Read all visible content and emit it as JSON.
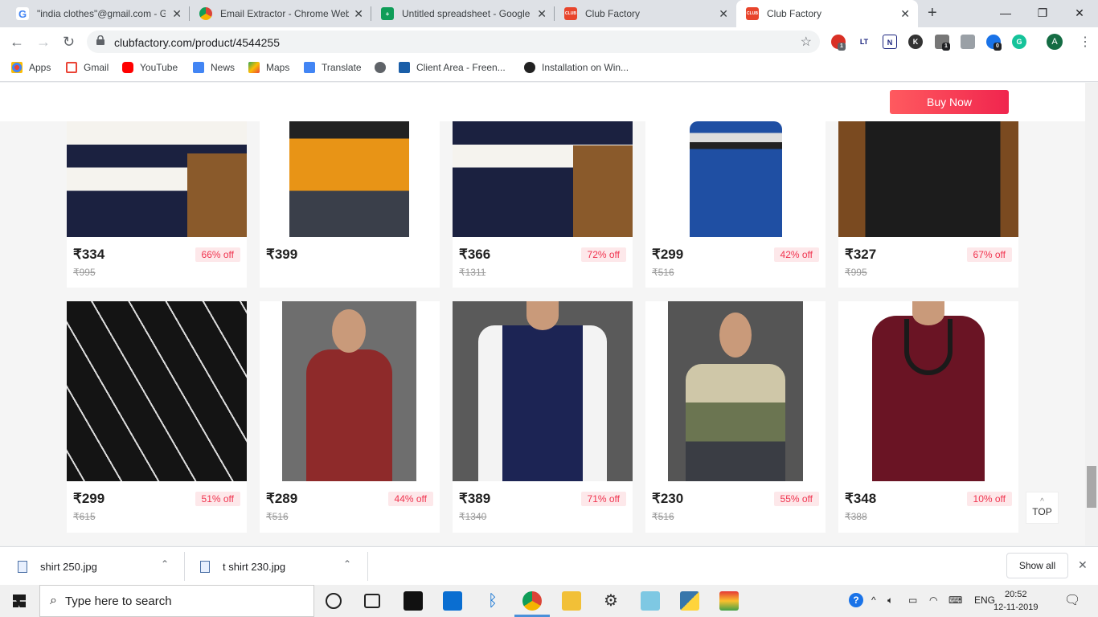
{
  "browser": {
    "tabs": [
      {
        "title": "\"india clothes\"@gmail.com - G",
        "icon": "google-g-icon"
      },
      {
        "title": "Email Extractor - Chrome Web",
        "icon": "chrome-webstore-icon"
      },
      {
        "title": "Untitled spreadsheet - Google",
        "icon": "sheets-icon"
      },
      {
        "title": "Club Factory",
        "icon": "clubfactory-icon"
      },
      {
        "title": "Club Factory",
        "icon": "clubfactory-icon"
      }
    ],
    "favicon_text": "CLUB",
    "url": "clubfactory.com/product/4544255",
    "avatar_initial": "A",
    "ext_badges": [
      "1",
      "1",
      "0"
    ],
    "ext_letters": [
      "LT",
      "N",
      "K",
      "G"
    ]
  },
  "bookmarks": [
    {
      "label": "Apps",
      "icon": "apps-grid-icon"
    },
    {
      "label": "Gmail",
      "icon": "gmail-icon"
    },
    {
      "label": "YouTube",
      "icon": "youtube-icon"
    },
    {
      "label": "News",
      "icon": "news-icon"
    },
    {
      "label": "Maps",
      "icon": "maps-icon"
    },
    {
      "label": "Translate",
      "icon": "translate-icon"
    },
    {
      "label": "",
      "icon": "globe-icon"
    },
    {
      "label": "Client Area - Freen...",
      "icon": "freenom-icon"
    },
    {
      "label": "Installation on Win...",
      "icon": "wordpress-icon"
    }
  ],
  "page": {
    "buy_now": "Buy Now",
    "top_label": "TOP",
    "products_row1": [
      {
        "price": "₹334",
        "original": "₹995",
        "discount": "66% off",
        "image": "white-navy-striped-sweater"
      },
      {
        "price": "₹399",
        "original": "",
        "discount": "",
        "image": "orange-black-colorblock-hoodie"
      },
      {
        "price": "₹366",
        "original": "₹1311",
        "discount": "72% off",
        "image": "navy-white-striped-sweater"
      },
      {
        "price": "₹299",
        "original": "₹516",
        "discount": "42% off",
        "image": "blue-striped-tshirt"
      },
      {
        "price": "₹327",
        "original": "₹995",
        "discount": "67% off",
        "image": "black-sweatshirt"
      }
    ],
    "products_row2": [
      {
        "price": "₹299",
        "original": "₹615",
        "discount": "51% off",
        "image": "black-line-print-tshirt"
      },
      {
        "price": "₹289",
        "original": "₹516",
        "discount": "44% off",
        "image": "maroon-navy-tshirt"
      },
      {
        "price": "₹389",
        "original": "₹1340",
        "discount": "71% off",
        "image": "navy-vest-white-shirt"
      },
      {
        "price": "₹230",
        "original": "₹516",
        "discount": "55% off",
        "image": "beige-olive-grey-tshirt"
      },
      {
        "price": "₹348",
        "original": "₹388",
        "discount": "10% off",
        "image": "maroon-shawl-collar-tshirt"
      }
    ]
  },
  "downloads": {
    "items": [
      {
        "name": "shirt 250.jpg"
      },
      {
        "name": "t shirt 230.jpg"
      }
    ],
    "show_all": "Show all"
  },
  "taskbar": {
    "search_placeholder": "Type here to search",
    "lang": "ENG",
    "time": "20:52",
    "date": "12-11-2019"
  },
  "colors": {
    "accent": "#f0254e",
    "discount_bg": "#fde8ea",
    "discount_text": "#f0344f"
  }
}
